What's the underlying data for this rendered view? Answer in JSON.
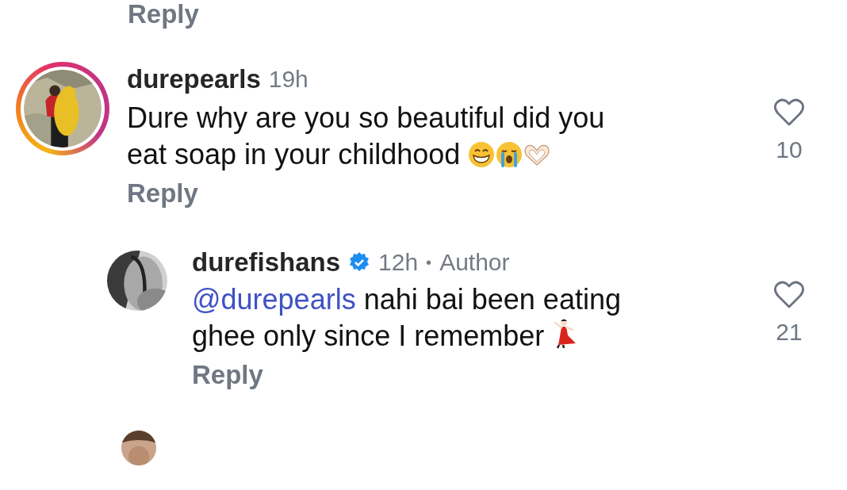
{
  "previous_reply": {
    "label": "Reply"
  },
  "comments": [
    {
      "username": "durepearls",
      "verified": false,
      "time": "19h",
      "has_story": true,
      "avatar": {
        "kind": "picture"
      },
      "text": "Dure why are you so beautiful did you eat soap in your childhood",
      "emojis": [
        {
          "kind": "grin"
        },
        {
          "kind": "sob"
        },
        {
          "kind": "heart_hands"
        }
      ],
      "reply_label": "Reply",
      "likes": "10",
      "nested": false
    },
    {
      "username": "durefishans",
      "verified": true,
      "time": "12h",
      "separator": "•",
      "author_tag": "Author",
      "has_story": false,
      "avatar": {
        "kind": "picture"
      },
      "mention": "@durepearls",
      "text": "nahi bai been eating ghee only since I remember",
      "emojis": [
        {
          "kind": "dancer"
        }
      ],
      "reply_label": "Reply",
      "likes": "21",
      "nested": true
    }
  ],
  "next_comment": {
    "avatar": {
      "kind": "picture"
    }
  }
}
